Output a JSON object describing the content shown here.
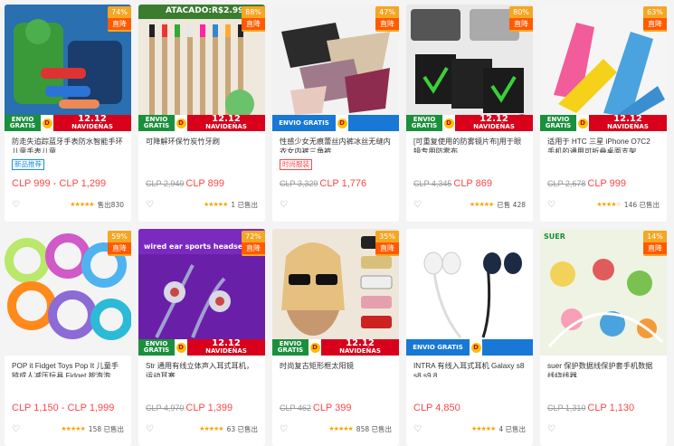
{
  "products": [
    {
      "title": "防走失追踪蓝牙手表防水智能手环儿童手表儿童",
      "tag": "新品推荐",
      "tag_color": "#1a8fe3",
      "price": "CLP 999 - CLP 1,299",
      "old_price": "",
      "rating": "★★★★★",
      "sold": "售出830",
      "badge_pct": "74%",
      "badge_word": "直降",
      "promo": true
    },
    {
      "title": "可降解环保竹炭竹牙刷",
      "tag": "",
      "tag_color": "",
      "price": "CLP 899",
      "old_price": "CLP 2,949",
      "rating": "★★★★★",
      "sold": "1 已售出",
      "badge_pct": "88%",
      "badge_word": "直降",
      "promo": true,
      "banner": "ATACADO:R$2.99"
    },
    {
      "title": "性感少女无痕蕾丝内裤冰丝无缝内衣女内裤三角裤",
      "tag": "时尚服装",
      "tag_color": "#ff4747",
      "price": "CLP 1,776",
      "old_price": "CLP 3,329",
      "rating": "",
      "sold": "",
      "badge_pct": "47%",
      "badge_word": "直降",
      "promo": true
    },
    {
      "title": "[可重复使用的防雾镜片布]用于眼镜专用防雾布",
      "tag": "",
      "tag_color": "",
      "price": "CLP 869",
      "old_price": "CLP 4,345",
      "rating": "★★★★★",
      "sold": "已售 428",
      "badge_pct": "80%",
      "badge_word": "直降",
      "promo": true
    },
    {
      "title": "适用于 HTC 三星 iPhone O7C2 手机的通用可折叠桌面支架",
      "tag": "",
      "tag_color": "",
      "price": "CLP 999",
      "old_price": "CLP 2,678",
      "rating": "★★★★☆",
      "sold": "146 已售出",
      "badge_pct": "63%",
      "badge_word": "直降",
      "promo": true
    },
    {
      "title": "POP it Fidget Toys Pop It 儿童手链成人减压玩具 Fidget 按泡泡",
      "tag": "",
      "tag_color": "",
      "price": "CLP 1,150 - CLP 1,999",
      "old_price": "",
      "rating": "★★★★★",
      "sold": "158 已售出",
      "badge_pct": "59%",
      "badge_word": "直降",
      "promo": false
    },
    {
      "title": "Str 通用有线立体声入耳式耳机，运动耳塞",
      "tag": "",
      "tag_color": "",
      "price": "CLP 1,399",
      "old_price": "CLP 4,970",
      "rating": "★★★★★",
      "sold": "63 已售出",
      "badge_pct": "72%",
      "badge_word": "直降",
      "promo": true,
      "banner": "wired ear sports headset"
    },
    {
      "title": "时尚复古矩形框太阳镜",
      "tag": "",
      "tag_color": "",
      "price": "CLP 399",
      "old_price": "CLP 462",
      "rating": "★★★★★",
      "sold": "858 已售出",
      "badge_pct": "35%",
      "badge_word": "直降",
      "promo": true
    },
    {
      "title": "INTRA 有线入耳式耳机 Galaxy s8 s8 s9 8",
      "tag": "",
      "tag_color": "",
      "price": "CLP 4,850",
      "old_price": "",
      "rating": "★★★★★",
      "sold": "4 已售出",
      "badge_pct": "",
      "badge_word": "",
      "promo": true
    },
    {
      "title": "suer 保护数据线保护套手机数据线绕线器",
      "tag": "",
      "tag_color": "",
      "price": "CLP 1,130",
      "old_price": "CLP 1,310",
      "rating": "",
      "sold": "",
      "badge_pct": "14%",
      "badge_word": "直降",
      "promo": false,
      "brand": "SUER"
    }
  ],
  "promo_text": {
    "green": "ENVIO GRATIS",
    "date": "12.12",
    "sub": "NAVIDEÑAS"
  },
  "colors": {
    "accent": "#ff4747",
    "badge": "#f5a623",
    "promo_red": "#d8001b",
    "promo_green": "#1a8f3c"
  }
}
